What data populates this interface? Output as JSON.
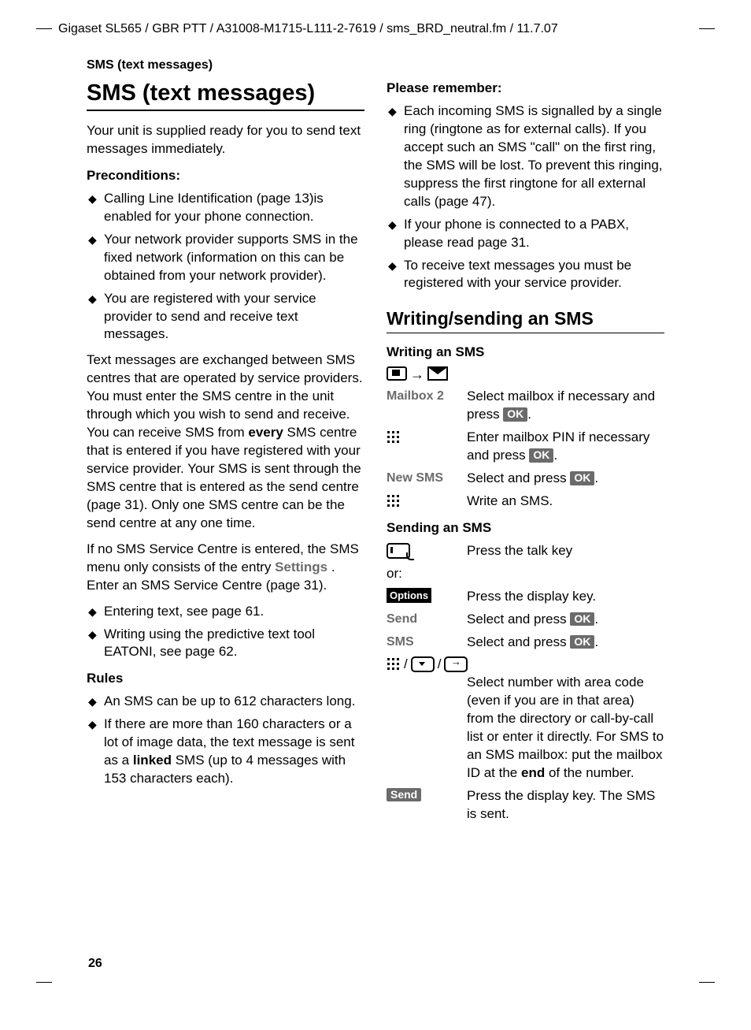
{
  "header": "Gigaset SL565 / GBR PTT / A31008-M1715-L111-2-7619 / sms_BRD_neutral.fm / 11.7.07",
  "section_label": "SMS (text messages)",
  "left": {
    "h1": "SMS (text messages)",
    "intro": "Your unit is supplied ready for you to send text messages immediately.",
    "preconditions_h": "Preconditions:",
    "preconditions": [
      "Calling Line Identification (page 13)is enabled for your phone connection.",
      "Your network provider supports SMS in the fixed network (information on this can be obtained from your network provider).",
      "You are registered with your service provider to send and receive text messages."
    ],
    "para1_pre": "Text messages are exchanged between SMS centres that are operated by service providers. You must enter the SMS centre in the unit through which you wish to send and receive. You can receive SMS from ",
    "para1_bold": "every",
    "para1_post": " SMS centre that is entered if you have registered with your service provider. Your SMS is sent through the SMS centre that is entered as the send centre (page 31). Only one SMS centre can be the send centre at any one time.",
    "para2_pre": "If no SMS Service Centre is entered, the SMS menu only consists of the entry ",
    "para2_gray": "Settings ",
    "para2_post": ". Enter an SMS Service Centre (page 31).",
    "tips": [
      "Entering text, see page 61.",
      "Writing using the predictive text tool EATONI, see page 62."
    ],
    "rules_h": "Rules",
    "rules_1": "An SMS can be up to 612 characters long.",
    "rules_2_pre": "If there are more than 160 characters or a lot of image data, the text message is sent as a ",
    "rules_2_bold": "linked",
    "rules_2_post": " SMS (up to 4 messages with 153 characters each)."
  },
  "right": {
    "remember_h": "Please remember:",
    "remember": [
      "Each incoming SMS is signalled by a single ring (ringtone as for external calls). If you accept such an SMS \"call\" on the first ring, the SMS will be lost. To prevent this ringing, suppress the first ringtone for all external calls (page 47).",
      "If your phone is connected to a PABX, please read page 31.",
      "To receive text messages you must be registered with your service provider."
    ],
    "h2": "Writing/sending an SMS",
    "writing_h": "Writing an SMS",
    "ok": "OK",
    "steps_writing": {
      "mailbox_key": "Mailbox 2",
      "mailbox_desc_pre": "Select mailbox if necessary and press ",
      "pin_desc_pre": "Enter mailbox PIN if necessary and press ",
      "newsms_key": "New SMS",
      "newsms_desc_pre": "Select and press ",
      "write_desc": "Write an SMS."
    },
    "sending_h": "Sending an SMS",
    "steps_sending": {
      "talk_desc": "Press the talk key",
      "or": "or:",
      "options_label": "Options",
      "options_desc": "Press the display key.",
      "send_key": "Send",
      "send_desc_pre": "Select and press ",
      "sms_key": "SMS",
      "sms_desc_pre": "Select and press ",
      "select_desc_pre": "Select number with area code (even if you are in that area) from the directory or call-by-call list or enter it directly. For SMS to an SMS mailbox: put the mailbox ID at the ",
      "select_desc_bold": "end",
      "select_desc_post": " of the number.",
      "send_label": "Send",
      "send_final": "Press the display key. The SMS is sent."
    }
  },
  "page_number": "26"
}
